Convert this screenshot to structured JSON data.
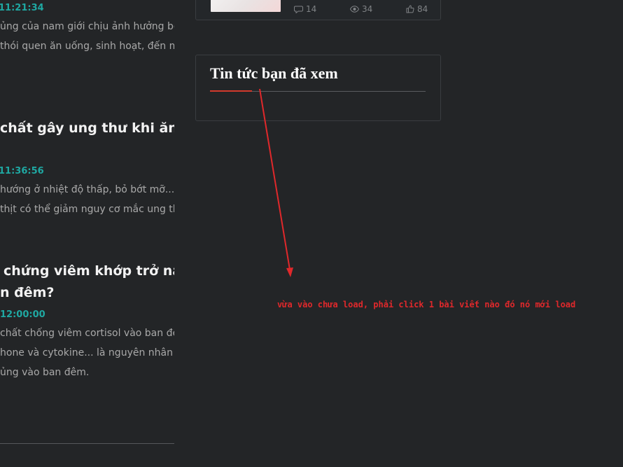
{
  "articles": [
    {
      "time": "11:21:34",
      "excerpt_lines": [
        "ủng của nam giới chịu ảnh hưởng bởi",
        "thói quen ăn uống, sinh hoạt, đến môi"
      ]
    },
    {
      "title_lines": [
        "chất gây ung thư khi ăn thịt"
      ],
      "time": "11:36:56",
      "excerpt_lines": [
        "hướng ở nhiệt độ thấp, bỏ bớt mỡ... trong",
        "thịt có thể giảm nguy cơ mắc ung thư."
      ]
    },
    {
      "title_lines": [
        "chứng viêm khớp trở nặng",
        "n đêm?"
      ],
      "time": "12:00:00",
      "excerpt_lines": [
        "chất chống viêm cortisol vào ban đêm,",
        "hone và cytokine... là nguyên nhân khiến",
        "ủng vào ban đêm."
      ]
    }
  ],
  "top_card": {
    "comments": "14",
    "views": "34",
    "likes": "84"
  },
  "widget": {
    "title": "Tin tức bạn đã xem"
  },
  "annotation": {
    "text": "vừa vào chưa load, phải click 1 bài viết nào đó nó mới load",
    "color": "#e0282b"
  },
  "colors": {
    "background": "#232527",
    "time_accent": "#1fa8a2",
    "title_underline_accent": "#d33a2c"
  }
}
